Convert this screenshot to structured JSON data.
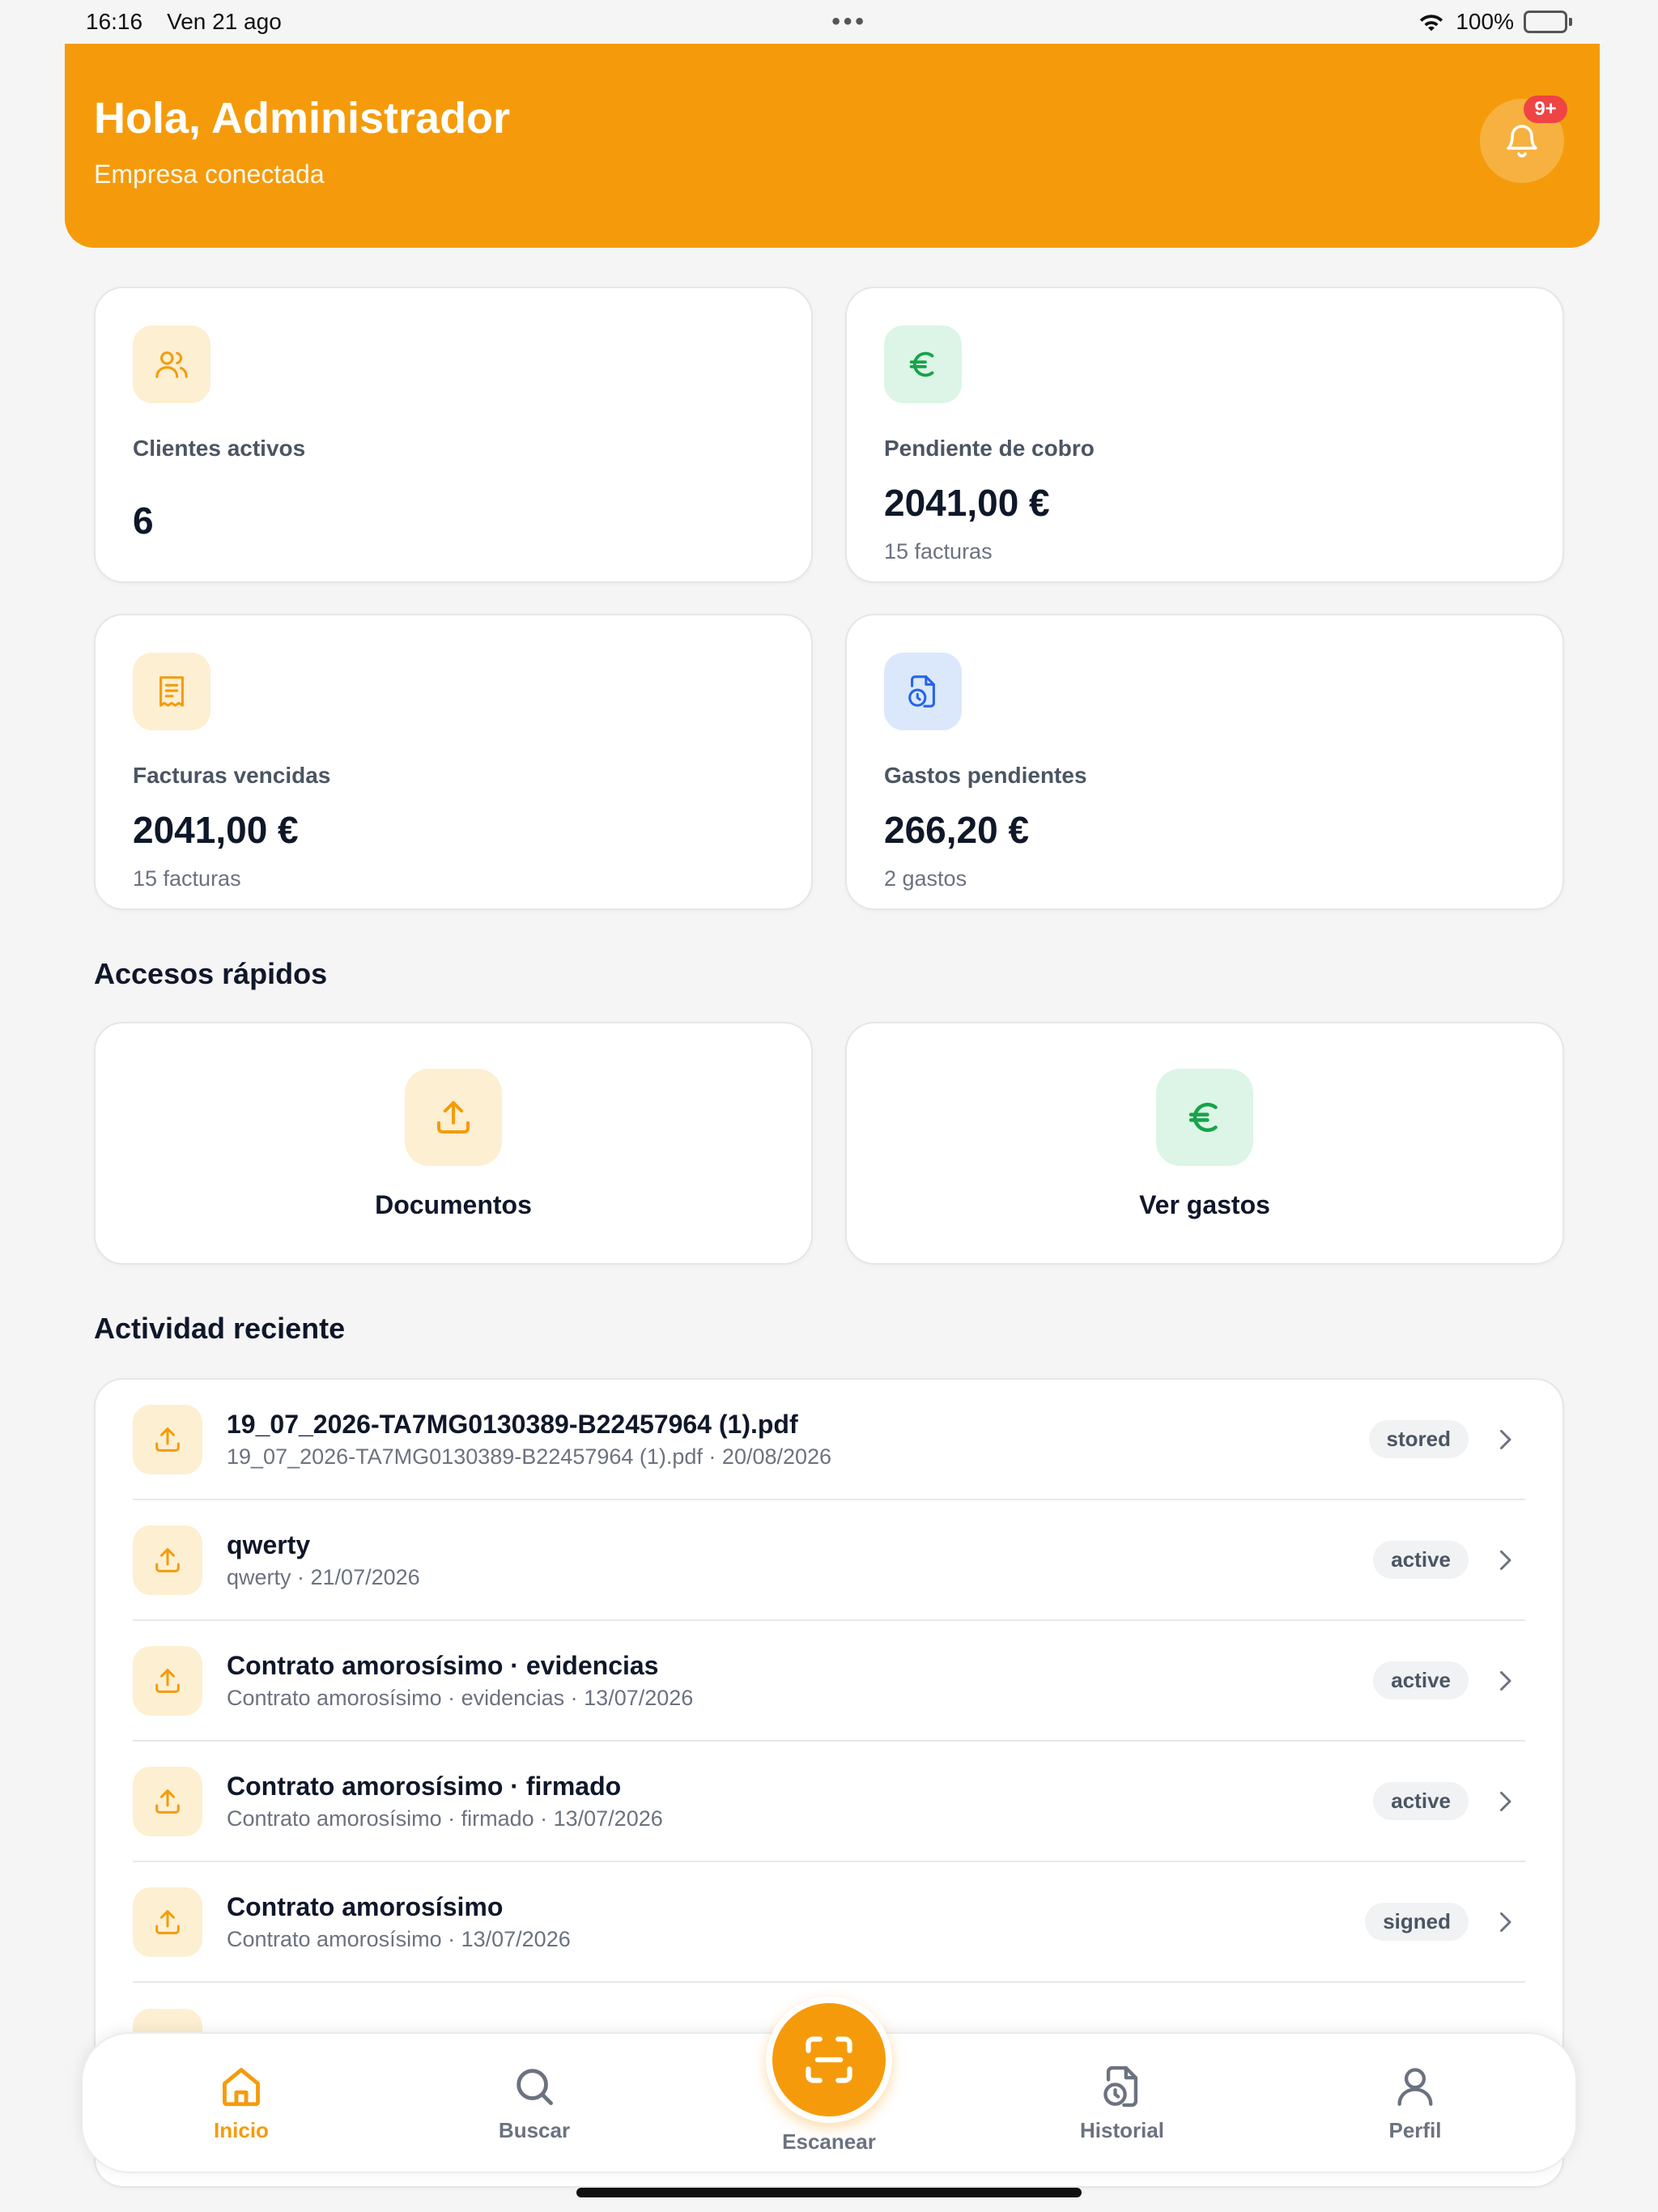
{
  "status_bar": {
    "time": "16:16",
    "date": "Ven 21 ago",
    "battery": "100%"
  },
  "header": {
    "title": "Hola, Administrador",
    "subtitle": "Empresa conectada",
    "notification_badge": "9+"
  },
  "stats": [
    {
      "label": "Clientes activos",
      "value": "6",
      "sub": ""
    },
    {
      "label": "Pendiente de cobro",
      "value": "2041,00 €",
      "sub": "15 facturas"
    },
    {
      "label": "Facturas vencidas",
      "value": "2041,00 €",
      "sub": "15 facturas"
    },
    {
      "label": "Gastos pendientes",
      "value": "266,20 €",
      "sub": "2 gastos"
    }
  ],
  "quick_access": {
    "title": "Accesos rápidos",
    "items": [
      {
        "label": "Documentos",
        "icon": "upload-icon"
      },
      {
        "label": "Ver gastos",
        "icon": "euro-icon"
      }
    ]
  },
  "activity": {
    "title": "Actividad reciente",
    "items": [
      {
        "title": "19_07_2026-TA7MG0130389-B22457964 (1).pdf",
        "sub": "19_07_2026-TA7MG0130389-B22457964 (1).pdf · 20/08/2026",
        "status": "stored"
      },
      {
        "title": "qwerty",
        "sub": "qwerty · 21/07/2026",
        "status": "active"
      },
      {
        "title": "Contrato amorosísimo · evidencias",
        "sub": "Contrato amorosísimo · evidencias · 13/07/2026",
        "status": "active"
      },
      {
        "title": "Contrato amorosísimo · firmado",
        "sub": "Contrato amorosísimo · firmado · 13/07/2026",
        "status": "active"
      },
      {
        "title": "Contrato amorosísimo",
        "sub": "Contrato amorosísimo · 13/07/2026",
        "status": "signed"
      }
    ]
  },
  "tabbar": {
    "items": [
      {
        "label": "Inicio",
        "icon": "home-icon",
        "active": true
      },
      {
        "label": "Buscar",
        "icon": "search-icon",
        "active": false
      },
      {
        "label": "Escanear",
        "icon": "scan-icon",
        "active": false
      },
      {
        "label": "Historial",
        "icon": "history-icon",
        "active": false
      },
      {
        "label": "Perfil",
        "icon": "user-icon",
        "active": false
      }
    ]
  },
  "colors": {
    "accent": "#f59b0b",
    "green": "#16a34a",
    "blue": "#2563eb",
    "badge_red": "#ef4444"
  }
}
